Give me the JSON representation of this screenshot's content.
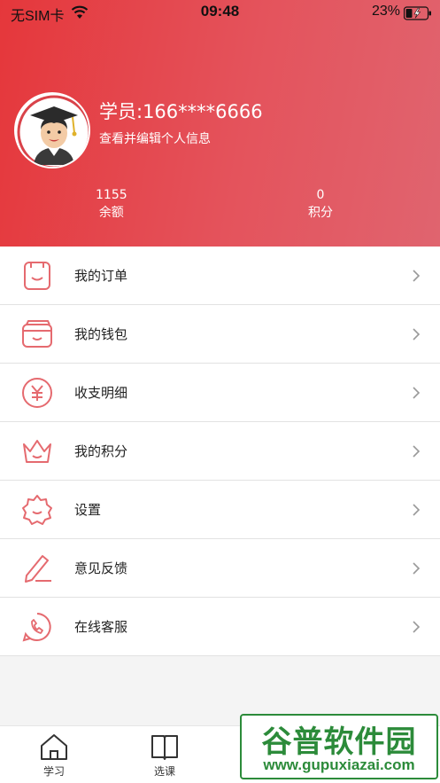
{
  "status_bar": {
    "carrier": "无SIM卡",
    "time": "09:48",
    "battery": "23%"
  },
  "profile": {
    "name": "学员:166****6666",
    "subtitle": "查看并编辑个人信息",
    "avatar_icon": "graduate-avatar-icon"
  },
  "stats": {
    "balance_value": "1155",
    "balance_label": "余额",
    "points_value": "0",
    "points_label": "积分"
  },
  "menu": [
    {
      "label": "我的订单",
      "icon": "order-icon"
    },
    {
      "label": "我的钱包",
      "icon": "wallet-icon"
    },
    {
      "label": "收支明细",
      "icon": "yen-icon"
    },
    {
      "label": "我的积分",
      "icon": "crown-icon"
    },
    {
      "label": "设置",
      "icon": "gear-icon"
    },
    {
      "label": "意见反馈",
      "icon": "pencil-icon"
    },
    {
      "label": "在线客服",
      "icon": "phone-icon"
    }
  ],
  "tabs": [
    {
      "label": "学习",
      "icon": "home-icon"
    },
    {
      "label": "选课",
      "icon": "book-icon"
    }
  ],
  "watermark": {
    "title": "谷普软件园",
    "url": "www.gupuxiazai.com"
  },
  "colors": {
    "header_start": "#e5373b",
    "header_end": "#e0646f",
    "icon_accent": "#e56a6f",
    "watermark_green": "#2c8b3a"
  }
}
